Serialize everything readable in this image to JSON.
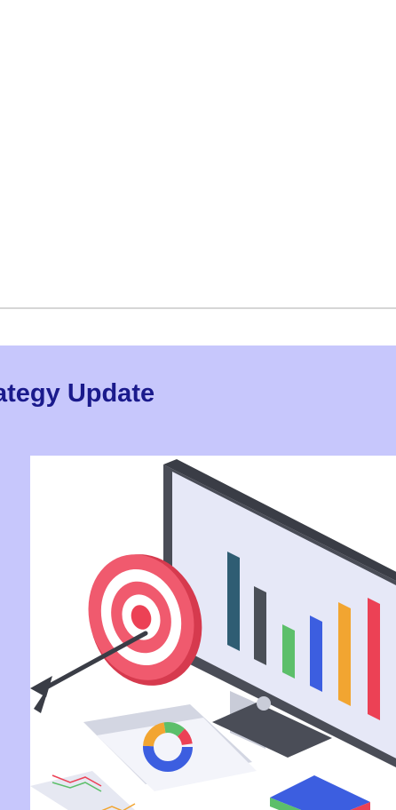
{
  "card": {
    "title": "ategy Update"
  },
  "illustration": {
    "icon": "strategy-analytics-illustration",
    "accent_colors": [
      "#2f5d73",
      "#4a4f57",
      "#5cbf6a",
      "#3c5ee0",
      "#f2a531",
      "#ec4155",
      "#f05a6e"
    ]
  }
}
